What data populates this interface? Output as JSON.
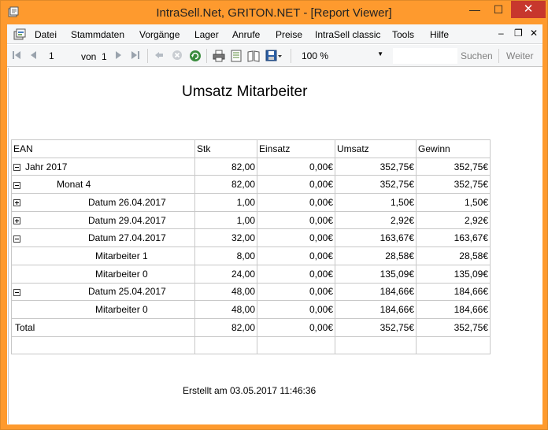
{
  "window": {
    "title": "IntraSell.Net, GRITON.NET - [Report Viewer]",
    "min_glyph": "—",
    "max_glyph": "☐",
    "close_glyph": "✕",
    "accent": "#fe9a2e",
    "close_color": "#c7372d"
  },
  "menu": {
    "items": [
      "Datei",
      "Stammdaten",
      "Vorgänge",
      "Lager",
      "Anrufe",
      "Preise",
      "IntraSell classic",
      "Tools",
      "Hilfe"
    ],
    "mdi_min": "–",
    "mdi_restore": "❐",
    "mdi_close": "✕"
  },
  "toolbar": {
    "page": "1",
    "of_label": "von",
    "total_pages": "1",
    "zoom": "100 %",
    "search_label": "Suchen",
    "next_label": "Weiter",
    "icons": [
      "first-page-icon",
      "previous-page-icon",
      "next-page-icon",
      "last-page-icon",
      "back-icon",
      "stop-icon",
      "refresh-icon",
      "print-icon",
      "print-layout-icon",
      "page-setup-icon",
      "export-icon"
    ]
  },
  "report": {
    "title": "Umsatz Mitarbeiter",
    "columns": [
      "EAN",
      "Stk",
      "Einsatz",
      "Umsatz",
      "Gewinn"
    ],
    "rows": [
      {
        "toggle": "minus",
        "label": "Jahr 2017",
        "stk": "82,00",
        "einsatz": "0,00€",
        "umsatz": "352,75€",
        "gewinn": "352,75€"
      },
      {
        "toggle": "minus",
        "label": "Monat 4",
        "stk": "82,00",
        "einsatz": "0,00€",
        "umsatz": "352,75€",
        "gewinn": "352,75€"
      },
      {
        "toggle": "plus",
        "label": "Datum 26.04.2017",
        "stk": "1,00",
        "einsatz": "0,00€",
        "umsatz": "1,50€",
        "gewinn": "1,50€"
      },
      {
        "toggle": "plus",
        "label": "Datum 29.04.2017",
        "stk": "1,00",
        "einsatz": "0,00€",
        "umsatz": "2,92€",
        "gewinn": "2,92€"
      },
      {
        "toggle": "minus",
        "label": "Datum 27.04.2017",
        "stk": "32,00",
        "einsatz": "0,00€",
        "umsatz": "163,67€",
        "gewinn": "163,67€"
      },
      {
        "toggle": "",
        "label": "Mitarbeiter 1",
        "stk": "8,00",
        "einsatz": "0,00€",
        "umsatz": "28,58€",
        "gewinn": "28,58€"
      },
      {
        "toggle": "",
        "label": "Mitarbeiter 0",
        "stk": "24,00",
        "einsatz": "0,00€",
        "umsatz": "135,09€",
        "gewinn": "135,09€"
      },
      {
        "toggle": "minus",
        "label": "Datum 25.04.2017",
        "stk": "48,00",
        "einsatz": "0,00€",
        "umsatz": "184,66€",
        "gewinn": "184,66€"
      },
      {
        "toggle": "",
        "label": "Mitarbeiter 0",
        "stk": "48,00",
        "einsatz": "0,00€",
        "umsatz": "184,66€",
        "gewinn": "184,66€"
      },
      {
        "toggle": "",
        "label": "Total",
        "stk": "82,00",
        "einsatz": "0,00€",
        "umsatz": "352,75€",
        "gewinn": "352,75€"
      },
      {
        "toggle": "",
        "label": "",
        "stk": "",
        "einsatz": "",
        "umsatz": "",
        "gewinn": ""
      }
    ],
    "footer": "Erstellt am 03.05.2017 11:46:36"
  }
}
